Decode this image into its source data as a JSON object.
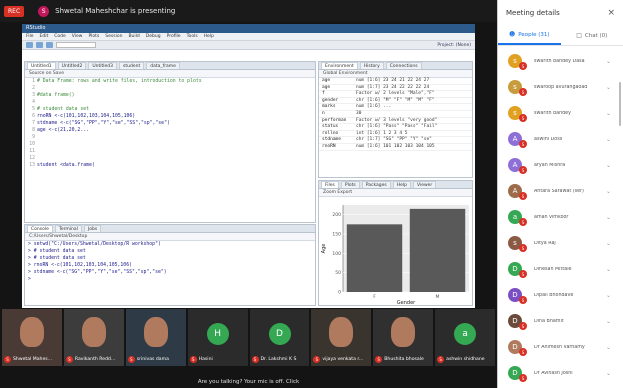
{
  "topbar": {
    "rec_label": "REC",
    "presenter_initial": "S",
    "presenting_text": "Shwetal Maheshchar is presenting"
  },
  "rstudio": {
    "title": "RStudio",
    "menu": [
      "File",
      "Edit",
      "Code",
      "View",
      "Plots",
      "Session",
      "Build",
      "Debug",
      "Profile",
      "Tools",
      "Help"
    ],
    "go_placeholder": "Go to file/function",
    "project": "Project: (None)",
    "source_tabs": [
      "Untitled1",
      "Untitled2",
      "Untitled3",
      "student",
      "data_frame"
    ],
    "source_toolbar": "Source on Save",
    "code_lines": [
      {
        "n": "1",
        "text": "# Data Frame: rows and write files, introduction to plots",
        "comment": true
      },
      {
        "n": "2",
        "text": "",
        "comment": false
      },
      {
        "n": "3",
        "text": "#data frame()",
        "comment": true
      },
      {
        "n": "4",
        "text": "",
        "comment": false
      },
      {
        "n": "5",
        "text": "# student data set",
        "comment": true
      },
      {
        "n": "6",
        "text": "rnoRN <-c(101,102,103,104,105,106)",
        "comment": false
      },
      {
        "n": "7",
        "text": "stdname <-c(\"SG\",\"PP\",\"Y\",\"se\",\"SS\",\"sp\",\"se\")",
        "comment": false
      },
      {
        "n": "8",
        "text": "age <-c(21,20,2...",
        "comment": false
      },
      {
        "n": "9",
        "text": "",
        "comment": false
      },
      {
        "n": "10",
        "text": "",
        "comment": false
      },
      {
        "n": "11",
        "text": "",
        "comment": false
      },
      {
        "n": "12",
        "text": "",
        "comment": false
      },
      {
        "n": "13",
        "text": "student <data.frame(",
        "comment": false
      }
    ],
    "console_tabs": [
      "Console",
      "Terminal",
      "Jobs"
    ],
    "console_path": "C:/Users/Shwetal/Desktop",
    "console_lines": [
      "> setwd(\"C:/Users/Shwetal/Desktop/R workshop\")",
      "> # student data set",
      "> # student data set",
      "> rnoRN <-c(101,102,103,104,105,106)",
      "> stdname <-c(\"SG\",\"PP\",\"Y\",\"se\",\"SS\",\"sp\",\"se\")",
      ">"
    ],
    "env_tabs": [
      "Environment",
      "History",
      "Connections"
    ],
    "env_sub": "Global Environment",
    "env_rows": [
      {
        "name": "age",
        "value": "num [1:6] 23 24 21 22 24 27"
      },
      {
        "name": "age",
        "value": "num [1:7] 23 24 22 22 22 24"
      },
      {
        "name": "f",
        "value": "Factor w/ 2 levels \"Male\",\"F\""
      },
      {
        "name": "gender",
        "value": "chr [1:6] \"M\" \"F\" \"M\" \"M\" \"F\""
      },
      {
        "name": "marks",
        "value": "num [1:6] ..."
      },
      {
        "name": "n",
        "value": "30"
      },
      {
        "name": "performan",
        "value": "Factor w/ 3 levels \"very good\""
      },
      {
        "name": "status",
        "value": "chr [1:6] \"Pass\" \"Pass\" \"Fail\""
      },
      {
        "name": "rollno",
        "value": "int [1:6] 1 2 3 4 5"
      },
      {
        "name": "stdname",
        "value": "chr [1:7] \"SG\" \"PP\" \"Y\" \"se\""
      },
      {
        "name": "rnoRN",
        "value": "num [1:6] 101 102 103 104 105"
      }
    ],
    "plot_tabs": [
      "Files",
      "Plots",
      "Packages",
      "Help",
      "Viewer"
    ],
    "plot_sub": "Zoom  Export"
  },
  "chart_data": {
    "type": "bar",
    "categories": [
      "F",
      "M"
    ],
    "values": [
      175,
      215
    ],
    "ylim": [
      0,
      225
    ],
    "yticks": [
      0,
      50,
      100,
      150,
      200
    ],
    "xlabel": "Gender",
    "ylabel": "Age",
    "bar_color": "#595959"
  },
  "participants_strip": [
    {
      "name": "Shwetal Mahes...",
      "type": "video1",
      "initial": ""
    },
    {
      "name": "Ravikanth Redd...",
      "type": "video2",
      "initial": ""
    },
    {
      "name": "srinivas dama",
      "type": "video3",
      "initial": ""
    },
    {
      "name": "Hasini",
      "type": "initial",
      "initial": "H",
      "color": "#34a853"
    },
    {
      "name": "Dr. Lakshmi K S",
      "type": "initial",
      "initial": "D",
      "color": "#34a853"
    },
    {
      "name": "vijaya venkata r...",
      "type": "video4",
      "initial": ""
    },
    {
      "name": "Bhushita bhosale",
      "type": "video5",
      "initial": ""
    },
    {
      "name": "ashwin shidhane",
      "type": "initial",
      "initial": "a",
      "color": "#34a853"
    }
  ],
  "bottombar": {
    "muted_message": "Are you talking? Your mic is off. Click"
  },
  "panel": {
    "title": "Meeting details",
    "close_icon": "×",
    "tab_people": "People (31)",
    "tab_chat": "Chat (0)",
    "people": [
      {
        "initial": "s",
        "name": "swarith bandey Dasa",
        "color": "#e0a020"
      },
      {
        "initial": "s",
        "name": "swaroop avurangaoad",
        "color": "#c89b3c"
      },
      {
        "initial": "s",
        "name": "swarith bandey",
        "color": "#e0a020"
      },
      {
        "initial": "A",
        "name": "aswini Doss",
        "color": "#8e6fd8"
      },
      {
        "initial": "A",
        "name": "aryan Mishra",
        "color": "#8e6fd8"
      },
      {
        "initial": "A",
        "name": "Antara Sarawat (ser)",
        "color": "#9e6b4a"
      },
      {
        "initial": "a",
        "name": "aman vimkoor",
        "color": "#34a853"
      },
      {
        "initial": "s",
        "name": "Ditya Raj",
        "color": "#8a5a44"
      },
      {
        "initial": "D",
        "name": "Dinesan Mittale",
        "color": "#34a853"
      },
      {
        "initial": "D",
        "name": "Dipali Bhondave",
        "color": "#7b4fc4"
      },
      {
        "initial": "D",
        "name": "Dina Bhamit",
        "color": "#6a4a3a"
      },
      {
        "initial": "D",
        "name": "Dr Animesh Varnamy",
        "color": "#b07a5e"
      },
      {
        "initial": "D",
        "name": "Dr Avinash Joshi",
        "color": "#34a853"
      }
    ]
  }
}
